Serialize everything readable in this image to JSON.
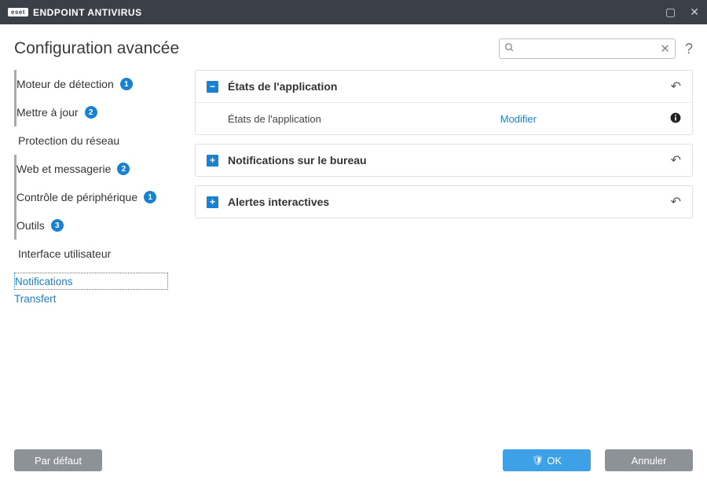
{
  "titlebar": {
    "logo": "eset",
    "product": "ENDPOINT ANTIVIRUS"
  },
  "header": {
    "page_title": "Configuration avancée",
    "search_placeholder": "",
    "help": "?"
  },
  "sidebar": {
    "items": [
      {
        "label": "Moteur de détection",
        "badge": "1",
        "bar": true
      },
      {
        "label": "Mettre à jour",
        "badge": "2",
        "bar": true
      },
      {
        "label": "Protection du réseau",
        "badge": null,
        "bar": false
      },
      {
        "label": "Web et messagerie",
        "badge": "2",
        "bar": true
      },
      {
        "label": "Contrôle de périphérique",
        "badge": "1",
        "bar": true
      },
      {
        "label": "Outils",
        "badge": "3",
        "bar": true
      },
      {
        "label": "Interface utilisateur",
        "badge": null,
        "bar": false
      }
    ],
    "sub_items": [
      {
        "label": "Notifications",
        "selected": true
      },
      {
        "label": "Transfert",
        "selected": false
      }
    ]
  },
  "panels": [
    {
      "expanded": true,
      "title": "États de l'application",
      "rows": [
        {
          "label": "États de l'application",
          "action": "Modifier"
        }
      ]
    },
    {
      "expanded": false,
      "title": "Notifications sur le bureau"
    },
    {
      "expanded": false,
      "title": "Alertes interactives"
    }
  ],
  "footer": {
    "default": "Par défaut",
    "ok": "OK",
    "cancel": "Annuler"
  }
}
